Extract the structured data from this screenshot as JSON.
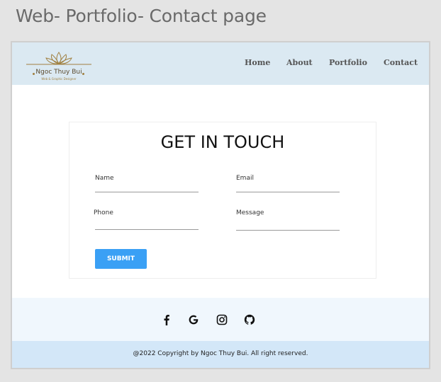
{
  "caption": "Web- Portfolio- Contact page",
  "brand": {
    "name": "Ngoc Thuy Bui",
    "tagline": "Web & Graphic Designer",
    "gold": "#a08040"
  },
  "nav": {
    "items": [
      {
        "label": "Home"
      },
      {
        "label": "About"
      },
      {
        "label": "Portfolio"
      },
      {
        "label": "Contact"
      }
    ]
  },
  "contact": {
    "title": "GET IN TOUCH",
    "fields": {
      "name": {
        "label": "Name",
        "value": ""
      },
      "email": {
        "label": "Email",
        "value": ""
      },
      "phone": {
        "label": "Phone",
        "value": ""
      },
      "message": {
        "label": "Message",
        "value": ""
      }
    },
    "submit_label": "SUBMIT",
    "accent": "#3aa0f5"
  },
  "social": {
    "icons": [
      "facebook-icon",
      "google-icon",
      "instagram-icon",
      "github-icon"
    ]
  },
  "footer": {
    "copyright": "@2022 Copyright by Ngoc Thuy Bui. All right reserved."
  },
  "colors": {
    "header_bg": "#dbe9f2",
    "social_bg": "#f0f7fd",
    "footer_bg": "#d3e7f8"
  }
}
